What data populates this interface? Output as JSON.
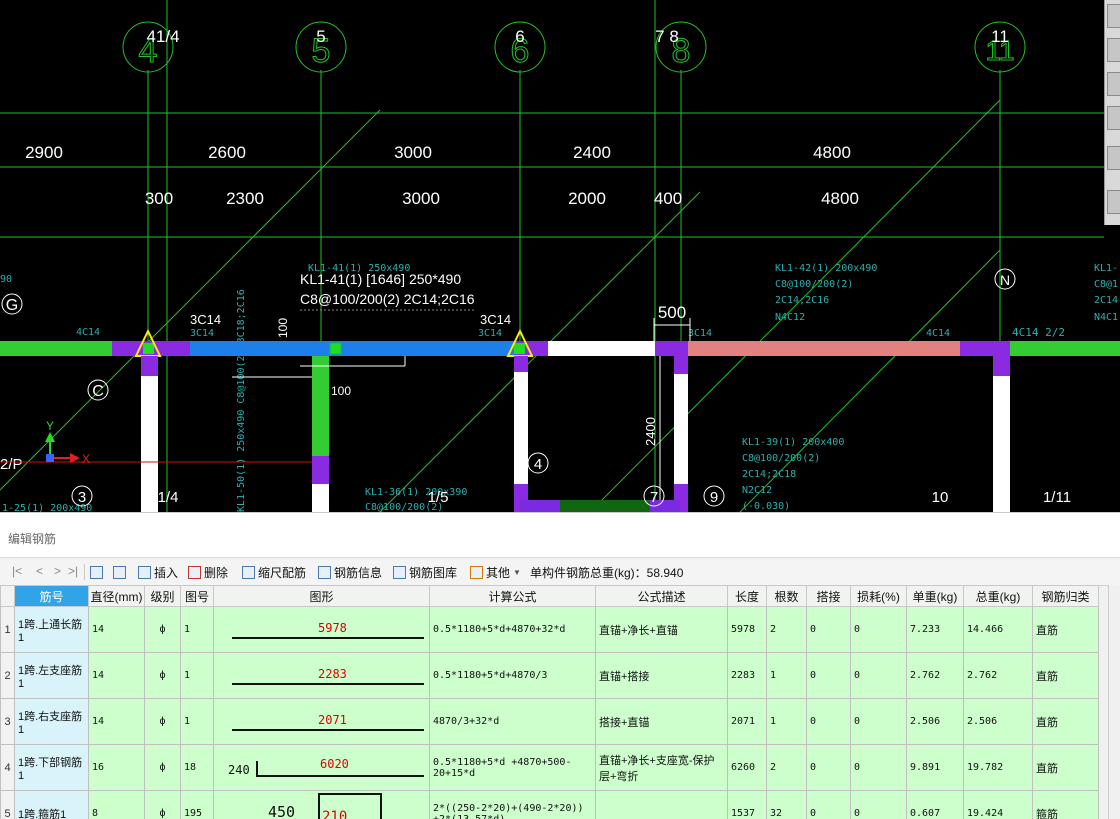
{
  "cad": {
    "axis_bubbles": [
      {
        "label": "4",
        "tag": "41/4"
      },
      {
        "label": "5",
        "tag": "5"
      },
      {
        "label": "6",
        "tag": "6"
      },
      {
        "label": "8",
        "tag": "7  8"
      },
      {
        "label": "11",
        "tag": "11"
      }
    ],
    "dims_row1": [
      "2900",
      "2600",
      "3000",
      "2400",
      "4800"
    ],
    "dims_row2": [
      "300",
      "2300",
      "3000",
      "2000",
      "400",
      "4800"
    ],
    "beam_label_1": "KL1-41(1) [1646] 250*490",
    "beam_label_2": "C8@100/200(2) 2C14;2C16",
    "rebar_tags": [
      "3C14",
      "3C14",
      "3C14",
      "3C14",
      "4C14 2/2",
      "4C14",
      "3C14"
    ],
    "dim_500": "500",
    "dim_2400": "2400",
    "dim_100a": "100",
    "dim_100b": "100",
    "grid_labels": [
      "G",
      "C",
      "N",
      "3",
      "1/4",
      "1/5",
      "4",
      "7",
      "9",
      "10",
      "1/11",
      "2/P"
    ],
    "small_annot_1": [
      "KL1-41(1) 250x490",
      "C8@100/200(2)",
      "2C14;2C16"
    ],
    "small_annot_2": [
      "KL1-42(1) 200x490",
      "C8@100/200(2)",
      "2C14;2C16",
      "N4C12"
    ],
    "small_annot_3": [
      "KL1-39(1) 200x400",
      "C8@100/200(2)",
      "2C14;2C18",
      "N2C12",
      "(-0.030)"
    ],
    "small_annot_4": [
      "KL1-36(1) 200x390",
      "C8@100/200(2)"
    ],
    "small_annot_5": [
      "KL1-",
      "C8@1",
      "2C14",
      "N4C1"
    ],
    "small_annot_vert": "KL1-50(1) 250x490  C8@100(2) 3C18;2C16",
    "left_edge": [
      "90",
      "1-25(1) 200x490",
      "4C14"
    ],
    "axis_x": "X",
    "axis_y": "Y"
  },
  "panel": {
    "title": "编辑钢筋",
    "toolbar": {
      "nav": [
        "|<",
        "<",
        ">",
        ">|"
      ],
      "insert": "插入",
      "delete": "删除",
      "scale_rebar": "缩尺配筋",
      "rebar_info": "钢筋信息",
      "rebar_library": "钢筋图库",
      "other": "其他",
      "total_weight": "单构件钢筋总重(kg)：58.940"
    },
    "columns": [
      "筋号",
      "直径(mm)",
      "级别",
      "图号",
      "图形",
      "计算公式",
      "公式描述",
      "长度",
      "根数",
      "搭接",
      "损耗(%)",
      "单重(kg)",
      "总重(kg)",
      "钢筋归类"
    ],
    "rows": [
      {
        "idx": "1",
        "name": "1跨.上通长筋1",
        "dia": "14",
        "grade": "ф",
        "fig": "1",
        "shape_left": "",
        "shape_num": "5978",
        "formula": "0.5*1180+5*d+4870+32*d",
        "desc": "直锚+净长+直锚",
        "len": "5978",
        "count": "2",
        "lap": "0",
        "loss": "0",
        "unit_w": "7.233",
        "total_w": "14.466",
        "cat": "直筋"
      },
      {
        "idx": "2",
        "name": "1跨.左支座筋1",
        "dia": "14",
        "grade": "ф",
        "fig": "1",
        "shape_left": "",
        "shape_num": "2283",
        "formula": "0.5*1180+5*d+4870/3",
        "desc": "直锚+搭接",
        "len": "2283",
        "count": "1",
        "lap": "0",
        "loss": "0",
        "unit_w": "2.762",
        "total_w": "2.762",
        "cat": "直筋"
      },
      {
        "idx": "3",
        "name": "1跨.右支座筋1",
        "dia": "14",
        "grade": "ф",
        "fig": "1",
        "shape_left": "",
        "shape_num": "2071",
        "formula": "4870/3+32*d",
        "desc": "搭接+直锚",
        "len": "2071",
        "count": "1",
        "lap": "0",
        "loss": "0",
        "unit_w": "2.506",
        "total_w": "2.506",
        "cat": "直筋"
      },
      {
        "idx": "4",
        "name": "1跨.下部钢筋1",
        "dia": "16",
        "grade": "ф",
        "fig": "18",
        "shape_left": "240",
        "shape_num": "6020",
        "formula": "0.5*1180+5*d +4870+500-20+15*d",
        "desc": "直锚+净长+支座宽-保护层+弯折",
        "len": "6260",
        "count": "2",
        "lap": "0",
        "loss": "0",
        "unit_w": "9.891",
        "total_w": "19.782",
        "cat": "直筋"
      },
      {
        "idx": "5",
        "name": "1跨.箍筋1",
        "dia": "8",
        "grade": "ф",
        "fig": "195",
        "shape_left": "450",
        "shape_num": "210",
        "formula": "2*((250-2*20)+(490-2*20)) +2*(13.57*d)",
        "desc": "",
        "len": "1537",
        "count": "32",
        "lap": "0",
        "loss": "0",
        "unit_w": "0.607",
        "total_w": "19.424",
        "cat": "箍筋"
      }
    ]
  }
}
